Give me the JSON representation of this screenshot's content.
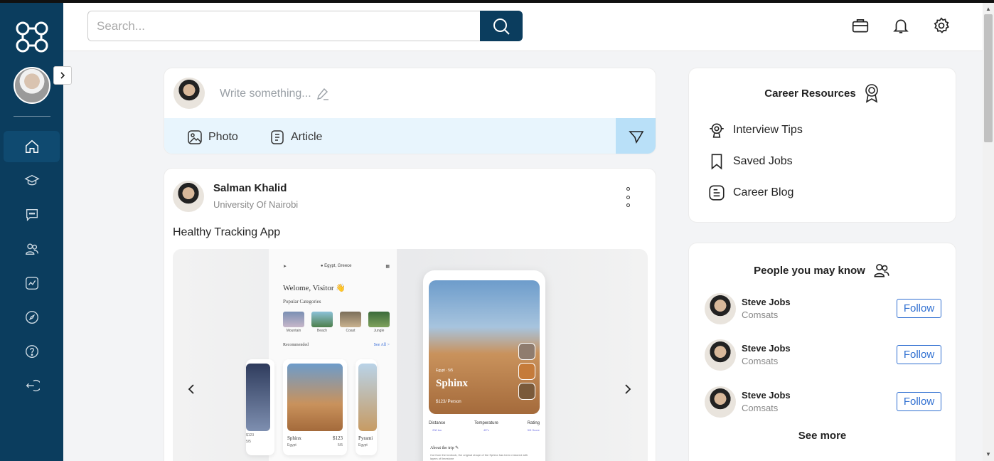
{
  "search": {
    "placeholder": "Search..."
  },
  "composer": {
    "placeholder": "Write something...",
    "photo_label": "Photo",
    "article_label": "Article"
  },
  "post": {
    "author": "Salman Khalid",
    "subtitle": "University Of Nairobi",
    "text": "Healthy Tracking App",
    "media": {
      "welcome": "Welome, Visitor 👋",
      "popular": "Popular Categories",
      "categories": [
        "Mountain",
        "Beach",
        "Coast",
        "Jungle"
      ],
      "recommended": "Recommended",
      "see_all": "See All >",
      "cards": [
        {
          "name": "",
          "price": "$123",
          "rating": "5/5"
        },
        {
          "name": "Sphinx",
          "price": "$123",
          "rating": "5/5",
          "loc": "Egypt"
        },
        {
          "name": "Pyrami",
          "price": "",
          "rating": "",
          "loc": "Egypt"
        }
      ],
      "detail_title": "Sphinx",
      "detail_loc": "Egypt · 5/5",
      "detail_price": "$123/ Person",
      "stats": [
        {
          "label": "Distance",
          "value": "200 km"
        },
        {
          "label": "Temperature",
          "value": "45°c"
        },
        {
          "label": "Rating",
          "value": "5/5 Score"
        }
      ],
      "about": "About the trip ✎",
      "about_text": "Cut from the bedrock, the original shape of the Sphinx has been restored with layers of limestone"
    }
  },
  "career": {
    "title": "Career Resources",
    "items": [
      {
        "label": "Interview Tips",
        "icon": "lightbulb-icon"
      },
      {
        "label": "Saved Jobs",
        "icon": "bookmark-icon"
      },
      {
        "label": "Career Blog",
        "icon": "blog-icon"
      }
    ]
  },
  "people": {
    "title": "People you may know",
    "list": [
      {
        "name": "Steve Jobs",
        "sub": "Comsats",
        "action": "Follow"
      },
      {
        "name": "Steve Jobs",
        "sub": "Comsats",
        "action": "Follow"
      },
      {
        "name": "Steve Jobs",
        "sub": "Comsats",
        "action": "Follow"
      }
    ],
    "see_more": "See more"
  },
  "colors": {
    "sidebar": "#0b3d5e",
    "accent": "#2f6fd1",
    "compose_bar": "#e8f5fd"
  }
}
